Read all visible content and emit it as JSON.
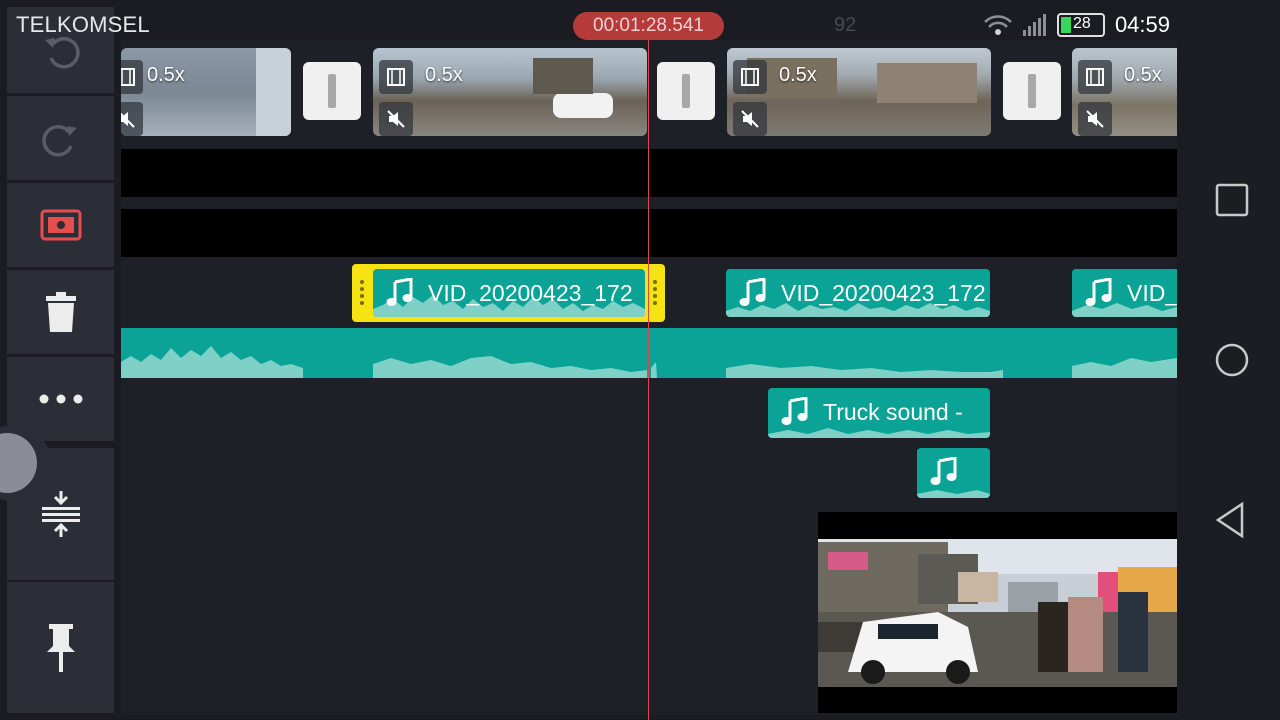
{
  "status": {
    "carrier": "TELKOMSEL",
    "time": "04:59",
    "battery_text": "28"
  },
  "editor": {
    "playhead_time": "00:01:28.541",
    "ghost_number": "92"
  },
  "tools": [
    {
      "name": "undo-icon"
    },
    {
      "name": "redo-icon"
    },
    {
      "name": "screen-capture-icon"
    },
    {
      "name": "trash-icon"
    },
    {
      "name": "more-icon"
    },
    {
      "name": "zoom-fit-icon"
    },
    {
      "name": "pin-icon"
    }
  ],
  "video_clips": [
    {
      "speed": "0.5x"
    },
    {
      "speed": "0.5x"
    },
    {
      "speed": "0.5x"
    },
    {
      "speed": "0.5x"
    }
  ],
  "audio_clips": [
    {
      "label": "VID_20200423_172"
    },
    {
      "label": "VID_20200423_172"
    },
    {
      "label": "VID_"
    },
    {
      "label": "Truck sound -"
    },
    {
      "label": ""
    }
  ],
  "colors": {
    "accent_teal": "#0aa396",
    "selected_yellow": "#f6e311",
    "playhead_red": "#d84a4a",
    "panel": "#2b2e37"
  }
}
